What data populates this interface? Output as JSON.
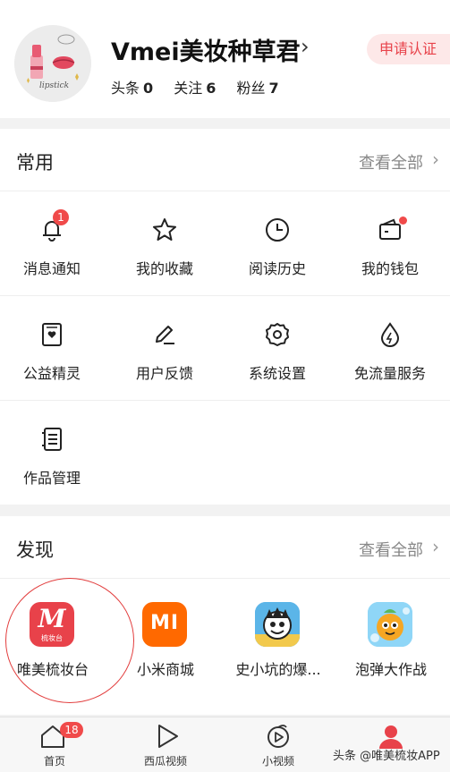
{
  "profile": {
    "name": "Vmei美妆种草君",
    "avatar_text": "lipstick",
    "stats": [
      {
        "label": "头条",
        "value": "0"
      },
      {
        "label": "关注",
        "value": "6"
      },
      {
        "label": "粉丝",
        "value": "7"
      }
    ],
    "verify_label": "申请认证"
  },
  "common": {
    "title": "常用",
    "more_label": "查看全部",
    "items": [
      {
        "label": "消息通知",
        "icon": "bell-icon",
        "badge": "1"
      },
      {
        "label": "我的收藏",
        "icon": "star-icon"
      },
      {
        "label": "阅读历史",
        "icon": "clock-icon"
      },
      {
        "label": "我的钱包",
        "icon": "wallet-icon"
      },
      {
        "label": "公益精灵",
        "icon": "heart-box-icon"
      },
      {
        "label": "用户反馈",
        "icon": "pen-icon"
      },
      {
        "label": "系统设置",
        "icon": "gear-icon"
      },
      {
        "label": "免流量服务",
        "icon": "droplet-icon"
      },
      {
        "label": "作品管理",
        "icon": "document-icon"
      }
    ]
  },
  "discover": {
    "title": "发现",
    "more_label": "查看全部",
    "apps": [
      {
        "label": "唯美梳妆台",
        "icon": "meitu-app-icon",
        "icon_text": "梳妆台",
        "color": "#e8424a"
      },
      {
        "label": "小米商城",
        "icon": "mi-app-icon",
        "icon_text": "MI",
        "color": "#ff6900"
      },
      {
        "label": "史小坑的爆...",
        "icon": "cartoon-game-icon"
      },
      {
        "label": "泡弹大作战",
        "icon": "bubble-game-icon"
      }
    ]
  },
  "nav": {
    "items": [
      {
        "label": "首页",
        "icon": "home-icon",
        "badge": "18"
      },
      {
        "label": "西瓜视频",
        "icon": "play-icon"
      },
      {
        "label": "小视频",
        "icon": "small-video-icon"
      },
      {
        "label": "我的",
        "icon": "person-icon"
      }
    ]
  },
  "watermark": "头条 @唯美梳妆APP",
  "colors": {
    "accent": "#e8424a",
    "badge": "#f04a4a"
  }
}
